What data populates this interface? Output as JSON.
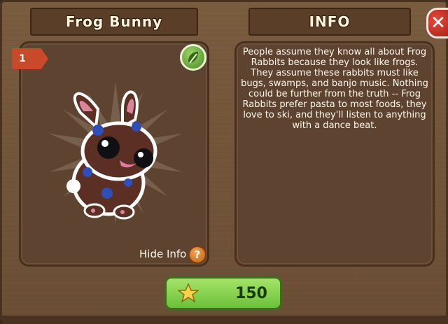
{
  "pet_card": {
    "name": "Frog Bunny",
    "level": "1",
    "info_heading": "INFO",
    "description": "People assume they know all about Frog Rabbits because they look like frogs.  They assume these rabbits must like bugs, swamps, and banjo music.  Nothing could be further from the truth -- Frog Rabbits prefer pasta to most foods, they love to ski, and they'll listen to anything with a dance beat.",
    "hide_info_label": "Hide Info",
    "help_symbol": "?",
    "price": "150",
    "close_symbol": "✕"
  },
  "icons": {
    "badge": "leaf-icon",
    "currency": "star-icon",
    "close": "close-icon",
    "help": "question-icon"
  },
  "colors": {
    "panel": "#6b4f35",
    "buy_button": "#6bc139",
    "close_button": "#c42e22",
    "level_tab": "#c84a2a",
    "pet_body": "#5b2f24",
    "pet_spots": "#2f4fb8"
  }
}
